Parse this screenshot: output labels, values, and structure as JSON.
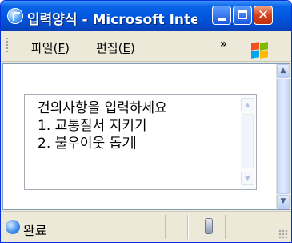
{
  "window": {
    "title": "입력양식 - Microsoft Internet Explorer"
  },
  "menu": {
    "items": [
      {
        "label": "파일(",
        "accel": "F",
        "suffix": ")"
      },
      {
        "label": "편집(",
        "accel": "E",
        "suffix": ")"
      }
    ],
    "overflow": "»"
  },
  "textarea": {
    "lines": [
      "건의사항을 입력하세요",
      "1. 교통질서 지키기",
      "2. 불우이웃 돕기"
    ]
  },
  "status": {
    "text": "완료"
  },
  "icons": {
    "app": "ie-icon",
    "minimize": "minimize-icon",
    "maximize": "maximize-icon",
    "close": "close-icon",
    "windows_logo": "windows-flag-icon",
    "status_page": "ie-page-icon",
    "zone": "security-zone-icon"
  },
  "colors": {
    "titlebar": "#0058e0",
    "close_button": "#d8401c",
    "chrome": "#ece9d8"
  }
}
